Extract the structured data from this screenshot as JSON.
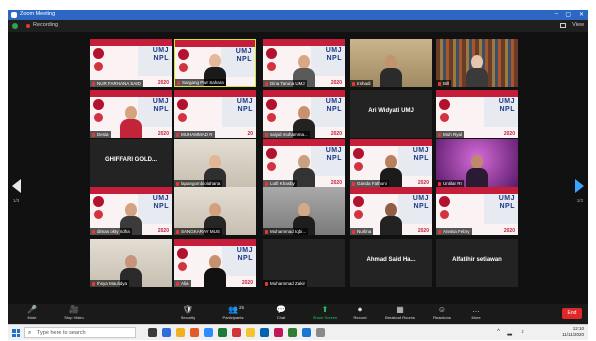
{
  "window": {
    "title": "Zoom Meeting"
  },
  "recording": {
    "label": "Recording",
    "view_label": "View"
  },
  "tiles": [
    {
      "row": 0,
      "col": 0,
      "name": "NUR FARHANA SAID",
      "kind": "banner",
      "year": "2020"
    },
    {
      "row": 0,
      "col": 1,
      "name": "Sargang Pwr Sahara",
      "kind": "banner",
      "year": "",
      "speaking": true,
      "person": {
        "skin": "#e4b89a",
        "shirt": "#1a1a1a"
      }
    },
    {
      "row": 0,
      "col": 2,
      "name": "Dina Taruna UMJ",
      "kind": "banner",
      "year": "2020",
      "person": {
        "skin": "#d9a883",
        "shirt": "#5a5a5a"
      }
    },
    {
      "row": 0,
      "col": 3,
      "name": "Irshadi",
      "kind": "room",
      "person": {
        "skin": "#c2946d",
        "shirt": "#2b2b2b"
      }
    },
    {
      "row": 0,
      "col": 4,
      "name": "Bill",
      "kind": "books",
      "person": {
        "skin": "#e8c6ae",
        "shirt": "#3a3a3a"
      }
    },
    {
      "row": 1,
      "col": 0,
      "name": "Desia",
      "kind": "banner",
      "year": "2020",
      "person": {
        "skin": "#d7a27f",
        "shirt": "#c2243a"
      }
    },
    {
      "row": 1,
      "col": 1,
      "name": "MUHAMMAD R",
      "kind": "banner",
      "year": "20"
    },
    {
      "row": 1,
      "col": 2,
      "name": "saiyid muhamma...",
      "kind": "banner",
      "year": "2020",
      "person": {
        "skin": "#c89270",
        "shirt": "#222222"
      }
    },
    {
      "row": 1,
      "col": 3,
      "name": "",
      "kind": "text",
      "ptext": "Ari Widyati UMJ"
    },
    {
      "row": 1,
      "col": 4,
      "name": "Muh Ryal",
      "kind": "banner",
      "year": "2020"
    },
    {
      "row": 2,
      "col": 0,
      "name": "",
      "kind": "text",
      "ptext": "GHIFFARI GOLD..."
    },
    {
      "row": 2,
      "col": 1,
      "name": "lapangombiolahana",
      "kind": "wall",
      "person": {
        "skin": "#e2b695",
        "shirt": "#2f2f2f"
      }
    },
    {
      "row": 2,
      "col": 2,
      "name": "Lutfi Khasby",
      "kind": "banner",
      "year": "2020",
      "person": {
        "skin": "#caa083",
        "shirt": "#333333"
      }
    },
    {
      "row": 2,
      "col": 3,
      "name": "Ganda Fathoni",
      "kind": "banner",
      "year": "2020",
      "person": {
        "skin": "#b98060",
        "shirt": "#1b1b1b"
      }
    },
    {
      "row": 2,
      "col": 4,
      "name": "Untilar RI",
      "kind": "purple",
      "person": {
        "skin": "#c08a6a",
        "shirt": "#2a1a33"
      }
    },
    {
      "row": 3,
      "col": 0,
      "name": "dimas okty ridha",
      "kind": "banner",
      "year": "2020",
      "person": {
        "skin": "#d4a182",
        "shirt": "#3b3b3b"
      }
    },
    {
      "row": 3,
      "col": 1,
      "name": "SANGKARAY MUS",
      "kind": "wall",
      "person": {
        "skin": "#d2a07d",
        "shirt": "#252525"
      }
    },
    {
      "row": 3,
      "col": 2,
      "name": "Muhammad Iqbi...",
      "kind": "grey",
      "person": {
        "skin": "#d6a888",
        "shirt": "#1e1e1e"
      }
    },
    {
      "row": 3,
      "col": 3,
      "name": "Nurlina",
      "kind": "banner",
      "year": "2020",
      "person": {
        "skin": "#8f5f45",
        "shirt": "#222222"
      }
    },
    {
      "row": 3,
      "col": 4,
      "name": "Annisa Febry",
      "kind": "banner",
      "year": "2020"
    },
    {
      "row": 4,
      "col": 0,
      "name": "Ihsya Maulidya",
      "kind": "wall",
      "person": {
        "skin": "#c7957a",
        "shirt": "#2a2a2a"
      }
    },
    {
      "row": 4,
      "col": 1,
      "name": "Alia",
      "kind": "banner",
      "year": "2020",
      "person": {
        "skin": "#c6916f",
        "shirt": "#111111"
      }
    },
    {
      "row": 4,
      "col": 2,
      "name": "Muhammad Zakir",
      "kind": "text",
      "ptext": ""
    },
    {
      "row": 4,
      "col": 3,
      "name": "",
      "kind": "text",
      "ptext": "Ahmad Said Ha..."
    },
    {
      "row": 4,
      "col": 4,
      "name": "",
      "kind": "text",
      "ptext": "Alfatihir setiawan"
    }
  ],
  "page": {
    "left": "1/3",
    "right": "1/3"
  },
  "toolbar": {
    "items": [
      {
        "label": "Mute",
        "glyph": "🎤"
      },
      {
        "label": "Stop Video",
        "glyph": "🎥"
      },
      {
        "label": "Security",
        "glyph": "🛡"
      },
      {
        "label": "Participants",
        "glyph": "👥",
        "badge": "25"
      },
      {
        "label": "Chat",
        "glyph": "💬"
      },
      {
        "label": "Share Screen",
        "glyph": "⬆"
      },
      {
        "label": "Record",
        "glyph": "⏺"
      },
      {
        "label": "Breakout Rooms",
        "glyph": "▦"
      },
      {
        "label": "Reactions",
        "glyph": "☺"
      },
      {
        "label": "More",
        "glyph": "…"
      }
    ],
    "end_label": "End"
  },
  "taskbar": {
    "search_placeholder": "Type here to search",
    "time": "12:10",
    "date": "11/11/2020"
  }
}
